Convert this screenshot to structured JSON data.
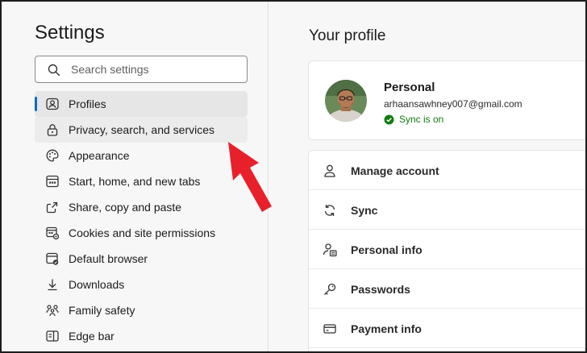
{
  "sidebar": {
    "title": "Settings",
    "search": {
      "placeholder": "Search settings",
      "value": ""
    },
    "items": [
      {
        "label": "Profiles",
        "icon": "profiles-icon",
        "active": true
      },
      {
        "label": "Privacy, search, and services",
        "icon": "lock-icon",
        "hovered": true
      },
      {
        "label": "Appearance",
        "icon": "palette-icon"
      },
      {
        "label": "Start, home, and new tabs",
        "icon": "home-tabs-icon"
      },
      {
        "label": "Share, copy and paste",
        "icon": "share-icon"
      },
      {
        "label": "Cookies and site permissions",
        "icon": "cookies-icon"
      },
      {
        "label": "Default browser",
        "icon": "default-browser-icon"
      },
      {
        "label": "Downloads",
        "icon": "download-icon"
      },
      {
        "label": "Family safety",
        "icon": "family-icon"
      },
      {
        "label": "Edge bar",
        "icon": "edge-bar-icon"
      }
    ]
  },
  "main": {
    "title": "Your profile",
    "profile": {
      "name": "Personal",
      "email": "arhaansawhney007@gmail.com",
      "sync_status": "Sync is on"
    },
    "options": [
      {
        "label": "Manage account",
        "icon": "person-icon"
      },
      {
        "label": "Sync",
        "icon": "sync-icon"
      },
      {
        "label": "Personal info",
        "icon": "personal-info-icon"
      },
      {
        "label": "Passwords",
        "icon": "key-icon"
      },
      {
        "label": "Payment info",
        "icon": "credit-card-icon"
      }
    ]
  },
  "colors": {
    "accent": "#0f6cbd",
    "sync_green": "#107c10",
    "annotation_arrow": "#e8202a"
  }
}
